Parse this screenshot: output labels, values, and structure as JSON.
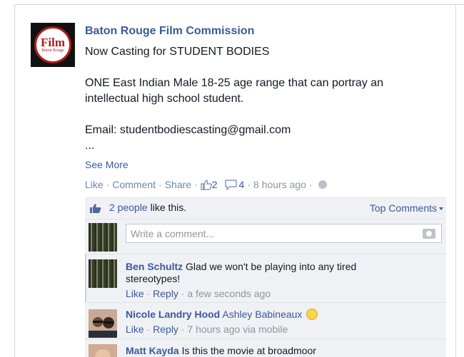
{
  "post": {
    "page_name": "Baton Rouge Film Commission",
    "logo": {
      "main": "Film",
      "sub": "Baton Rouge"
    },
    "lines": [
      "Now Casting for STUDENT BODIES",
      "ONE East Indian Male 18-25 age range that can portray an",
      "intellectual high school student.",
      "Email: studentbodiescasting@gmail.com",
      "..."
    ],
    "see_more": "See More"
  },
  "actions": {
    "like": "Like",
    "comment": "Comment",
    "share": "Share",
    "likes_count": "2",
    "comments_count": "4",
    "timestamp": "8 hours ago",
    "sep": "·"
  },
  "ufi": {
    "likes_link": "2 people",
    "likes_suffix": " like this.",
    "top_comments": "Top Comments",
    "write_placeholder": "Write a comment..."
  },
  "comments": [
    {
      "author": "Ben Schultz",
      "text_line1": "Glad we won't be playing into any tired",
      "text_line2": "stereotypes!",
      "like": "Like",
      "reply": "Reply",
      "time": "a few seconds ago"
    },
    {
      "author": "Nicole Landry Hood",
      "tag": "Ashley Babineaux",
      "like": "Like",
      "reply": "Reply",
      "time": "7 hours ago via mobile"
    },
    {
      "author": "Matt Kayda",
      "text": "Is this the movie at broadmoor"
    }
  ],
  "colors": {
    "link": "#3b5998",
    "ufi_bg": "#eff1f5",
    "logo_red": "#b01c1c"
  }
}
